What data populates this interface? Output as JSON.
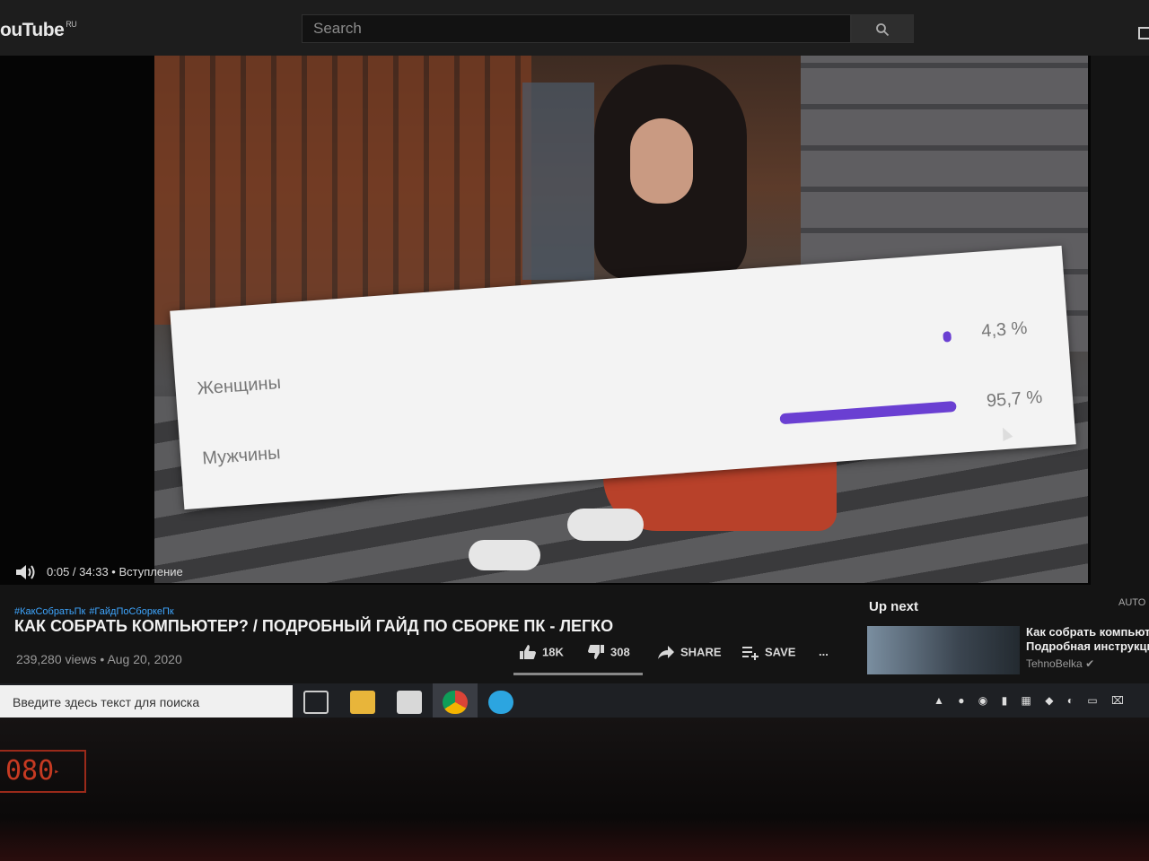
{
  "header": {
    "logo": "ouTube",
    "logo_region": "RU",
    "search_placeholder": "Search"
  },
  "player": {
    "time": "0:05 / 34:33 • Вступление",
    "audience": [
      {
        "label": "Женщины",
        "percent_text": "4,3 %",
        "share": 0.043
      },
      {
        "label": "Мужчины",
        "percent_text": "95,7 %",
        "share": 0.957
      }
    ]
  },
  "video": {
    "hashtags": [
      "#КакСобратьПк",
      "#ГайдПоСборкеПк"
    ],
    "title": "КАК СОБРАТЬ КОМПЬЮТЕР? / ПОДРОБНЫЙ ГАЙД ПО СБОРКЕ ПК - ЛЕГКО",
    "views": "239,280 views",
    "separator": "•",
    "date": "Aug 20, 2020",
    "likes": "18K",
    "dislikes": "308",
    "share_label": "SHARE",
    "save_label": "SAVE",
    "more_label": "..."
  },
  "up_next": {
    "heading": "Up next",
    "autoplay": "AUTO",
    "item_title_line1": "Как собрать компьют",
    "item_title_line2": "Подробная инструкци",
    "item_channel": "TehnoBelka"
  },
  "taskbar": {
    "search_placeholder": "Введите здесь текст для поиска"
  },
  "monitor": {
    "osd_value": "080"
  },
  "colors": {
    "accent_bar": "#6a3fd2",
    "hashtag": "#3ea6ff",
    "osd": "#c63a22"
  }
}
